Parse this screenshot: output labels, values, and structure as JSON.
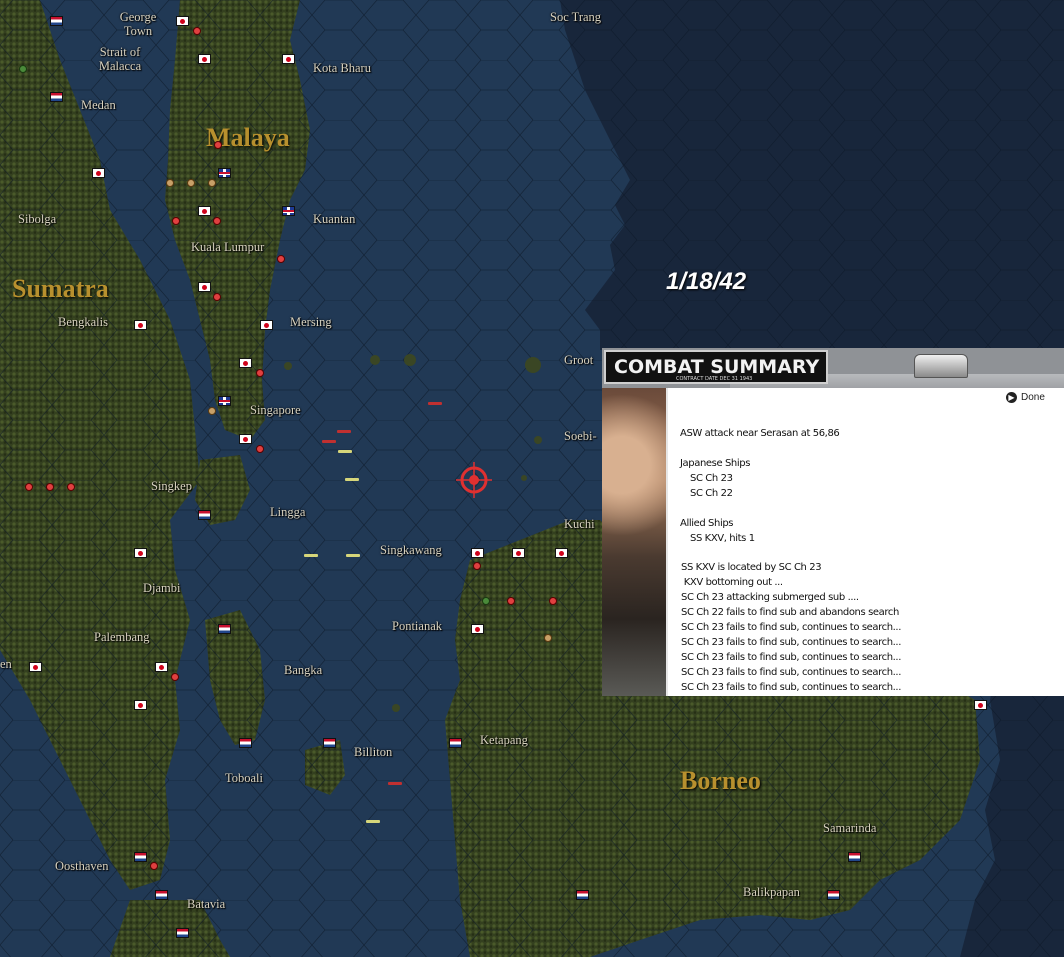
{
  "date": "1/18/42",
  "regions": [
    "Malaya",
    "Sumatra",
    "Borneo"
  ],
  "places": [
    "George Town",
    "Strait of Malacca",
    "Medan",
    "Kota Bharu",
    "Soc Trang",
    "Sibolga",
    "Kuala Lumpur",
    "Kuantan",
    "Bengkalis",
    "Mersing",
    "Singapore",
    "Groot",
    "Soebi-",
    "Singkep",
    "Lingga",
    "Kuchi",
    "Singkawang",
    "Djambi",
    "Pontianak",
    "Palembang",
    "Bangka",
    "Billiton",
    "Ketapang",
    "Toboali",
    "Samarinda",
    "Oosthaven",
    "Balikpapan",
    "Batavia",
    "en"
  ],
  "combat_summary": {
    "title": "COMBAT SUMMARY",
    "subtitle": "CONTRACT DATE DEC 31 1943",
    "done_label": "Done",
    "done_icon": "play-circle-icon",
    "header": "ASW attack near Serasan at 56,86",
    "japanese_label": "Japanese Ships",
    "japanese_ships": [
      "SC Ch 23",
      "SC Ch 22"
    ],
    "allied_label": "Allied Ships",
    "allied_ships": [
      "SS KXV, hits 1"
    ],
    "log": [
      "SS KXV is located by SC Ch 23",
      " KXV bottoming out ...",
      "SC Ch 23 attacking submerged sub ....",
      "SC Ch 22 fails to find sub and abandons search",
      "SC Ch 23 fails to find sub, continues to search...",
      "SC Ch 23 fails to find sub, continues to search...",
      "SC Ch 23 fails to find sub, continues to search...",
      "SC Ch 23 fails to find sub, continues to search...",
      "SC Ch 23 fails to find sub, continues to search..."
    ]
  },
  "colors": {
    "sea": "#1f3550",
    "deep_sea": "#17243a",
    "land": "#3f4a26",
    "flag_red": "#d0021b",
    "region_label": "#b8902e"
  }
}
